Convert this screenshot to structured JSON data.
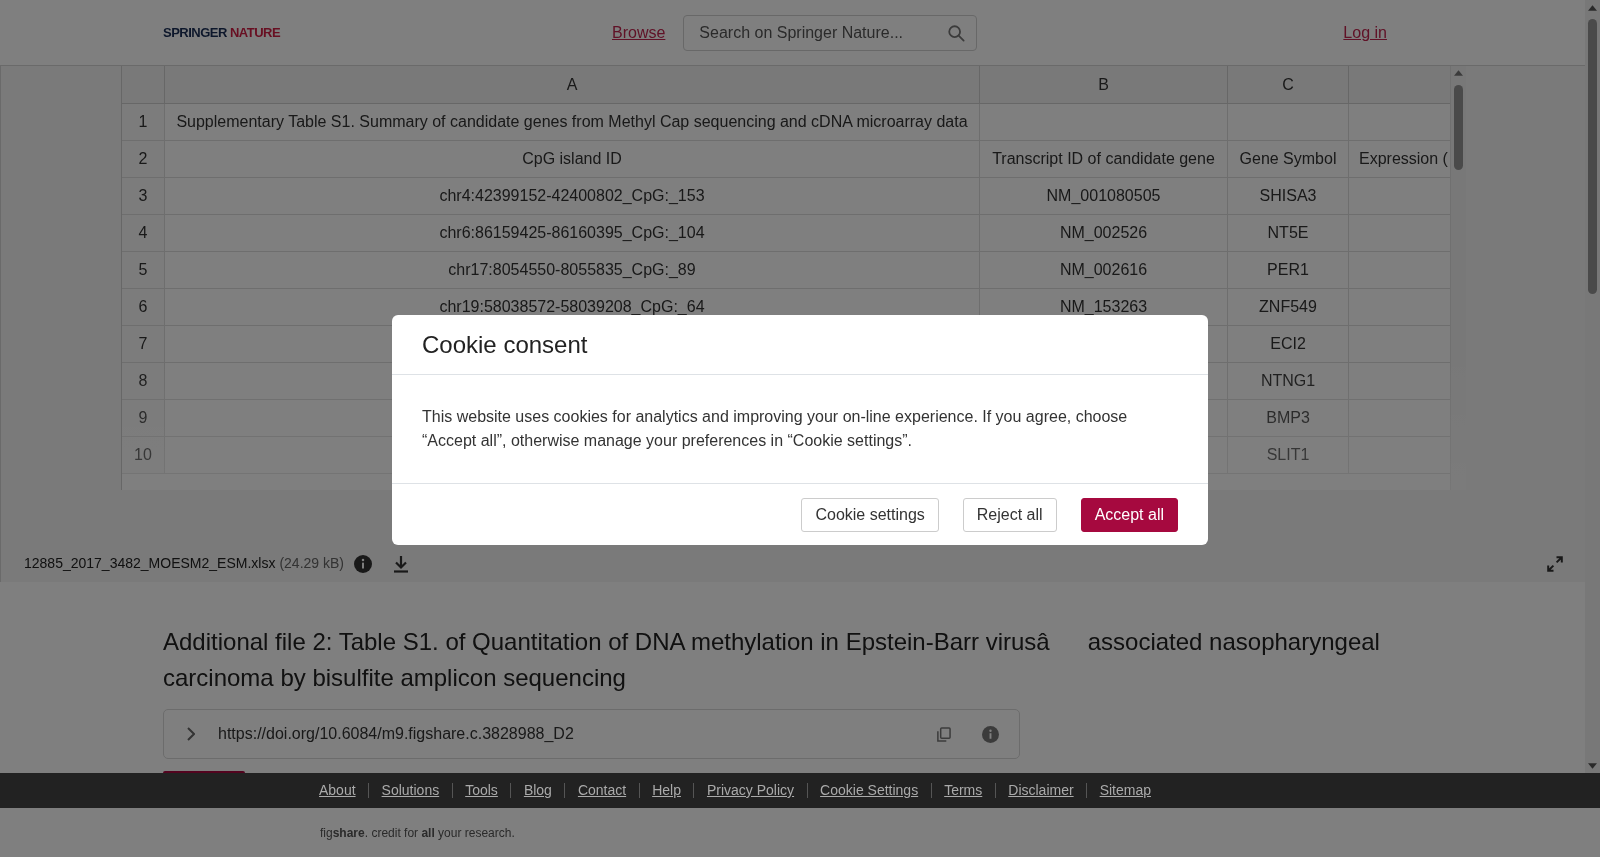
{
  "header": {
    "logo": [
      "SPRINGER",
      "NATURE"
    ],
    "browse_link": "Browse",
    "search": {
      "placeholder": "Search on Springer Nature..."
    },
    "login_link": "Log in"
  },
  "spreadsheet": {
    "columns": [
      "A",
      "B",
      "C"
    ],
    "rows": [
      {
        "number": "1",
        "cells": {
          "column_1": "Supplementary Table S1. Summary of candidate genes from Methyl Cap sequencing and cDNA microarray data"
        }
      },
      {
        "number": "2",
        "cells": {
          "column_1": "CpG island ID",
          "column_2": "Transcript ID of candidate gene",
          "column_3": "Gene Symbol",
          "column_4": "Expression ("
        }
      },
      {
        "number": "3",
        "cells": {
          "column_1": "chr4:42399152-42400802_CpG:_153",
          "column_2": "NM_001080505",
          "column_3": "SHISA3"
        }
      },
      {
        "number": "4",
        "cells": {
          "column_1": "chr6:86159425-86160395_CpG:_104",
          "column_2": "NM_002526",
          "column_3": "NT5E"
        }
      },
      {
        "number": "5",
        "cells": {
          "column_1": "chr17:8054550-8055835_CpG:_89",
          "column_2": "NM_002616",
          "column_3": "PER1"
        }
      },
      {
        "number": "6",
        "cells": {
          "column_1": "chr19:58038572-58039208_CpG:_64",
          "column_2": "NM_153263",
          "column_3": "ZNF549"
        }
      },
      {
        "number": "7",
        "cells": {
          "column_3": "ECI2"
        }
      },
      {
        "number": "8",
        "cells": {
          "column_3": "NTNG1"
        }
      },
      {
        "number": "9",
        "cells": {
          "column_3": "BMP3"
        }
      },
      {
        "number": "10",
        "cells": {
          "column_3": "SLIT1"
        }
      }
    ]
  },
  "file": {
    "name": "12885_2017_3482_MOESM2_ESM.xlsx",
    "size": "(24.29 kB)"
  },
  "item": {
    "title": "Additional file 2: Table S1. of Quantitation of DNA methylation in Epstein-Barr virusâassociated nasopharyngeal carcinoma by bisulfite amplicon sequencing",
    "doi": "https://doi.org/10.6084/m9.figshare.c.3828988_D2"
  },
  "footer": {
    "links": [
      "About",
      "Solutions",
      "Tools",
      "Blog",
      "Contact",
      "Help",
      "Privacy Policy",
      "Cookie Settings",
      "Terms",
      "Disclaimer",
      "Sitemap"
    ],
    "credit": "fig**share**. credit for **all** your research."
  },
  "cookie_dialog": {
    "title": "Cookie consent",
    "message": "This website uses cookies for analytics and improving your on-line experience. If you agree, choose “Accept all”, otherwise manage your preferences in “Cookie settings”.",
    "buttons": [
      {
        "label": "Cookie settings",
        "kind": "secondary"
      },
      {
        "label": "Reject all",
        "kind": "secondary"
      },
      {
        "label": "Accept all",
        "kind": "primary"
      }
    ]
  }
}
